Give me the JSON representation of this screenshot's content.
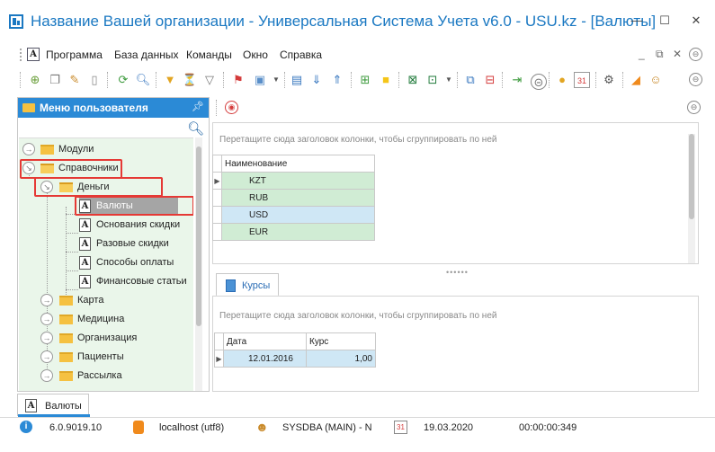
{
  "window": {
    "title": "Название Вашей организации - Универсальная Система Учета v6.0 - USU.kz - [Валюты]",
    "minimize": "—",
    "maximize": "☐",
    "close": "✕"
  },
  "menu": {
    "items": [
      "Программа",
      "База данных",
      "Команды",
      "Окно",
      "Справка"
    ],
    "mdi_minimize": "_",
    "mdi_restore": "⧉",
    "mdi_close": "✕"
  },
  "toolbar": {
    "icons": [
      "add-icon",
      "copy-icon",
      "edit-icon",
      "delete-icon",
      "refresh-icon",
      "search-icon",
      "filter-icon",
      "filter-clear-icon",
      "filter-settings-icon",
      "flag-icon",
      "image-icon",
      "grid-icon",
      "expand-icon",
      "collapse-icon",
      "add-row-icon",
      "note-icon",
      "export-excel-icon",
      "import-excel-icon",
      "new-window-icon",
      "close-window-icon",
      "exit-icon",
      "back-icon",
      "location-icon",
      "calendar-icon",
      "settings-icon",
      "rss-icon",
      "users-icon"
    ]
  },
  "left_panel": {
    "title": "Меню пользователя",
    "pin_icon": "pin-icon",
    "tree": [
      {
        "label": "Модули",
        "level": 0,
        "type": "folder",
        "expanded": false
      },
      {
        "label": "Справочники",
        "level": 0,
        "type": "folder",
        "expanded": true,
        "highlighted": true
      },
      {
        "label": "Деньги",
        "level": 1,
        "type": "folder",
        "expanded": true,
        "highlighted": true
      },
      {
        "label": "Валюты",
        "level": 2,
        "type": "doc",
        "selected": true,
        "highlighted": true
      },
      {
        "label": "Основания скидки",
        "level": 2,
        "type": "doc"
      },
      {
        "label": "Разовые скидки",
        "level": 2,
        "type": "doc"
      },
      {
        "label": "Способы оплаты",
        "level": 2,
        "type": "doc"
      },
      {
        "label": "Финансовые статьи",
        "level": 2,
        "type": "doc"
      },
      {
        "label": "Карта",
        "level": 1,
        "type": "folder",
        "expanded": false
      },
      {
        "label": "Медицина",
        "level": 1,
        "type": "folder",
        "expanded": false
      },
      {
        "label": "Организация",
        "level": 1,
        "type": "folder",
        "expanded": false
      },
      {
        "label": "Пациенты",
        "level": 1,
        "type": "folder",
        "expanded": false
      },
      {
        "label": "Рассылка",
        "level": 1,
        "type": "folder",
        "expanded": false
      }
    ]
  },
  "grid_top": {
    "group_hint": "Перетащите сюда заголовок колонки, чтобы сгруппировать по ней",
    "column": "Наименование",
    "rows": [
      "KZT",
      "RUB",
      "USD",
      "EUR"
    ]
  },
  "detail_tab": {
    "label": "Курсы"
  },
  "grid_bottom": {
    "group_hint": "Перетащите сюда заголовок колонки, чтобы сгруппировать по ней",
    "columns": [
      "Дата",
      "Курс"
    ],
    "rows": [
      [
        "12.01.2016",
        "1,00"
      ]
    ]
  },
  "bottom_tab": {
    "label": "Валюты"
  },
  "status": {
    "version": "6.0.9019.10",
    "server": "localhost (utf8)",
    "user": "SYSDBA (MAIN) - N",
    "date": "19.03.2020",
    "timer": "00:00:00:349"
  },
  "colors": {
    "accent": "#2b8ad6",
    "title": "#1a78c2",
    "highlight": "#e53935",
    "row_green": "#d0ecd4",
    "row_blue": "#cfe7f5"
  }
}
